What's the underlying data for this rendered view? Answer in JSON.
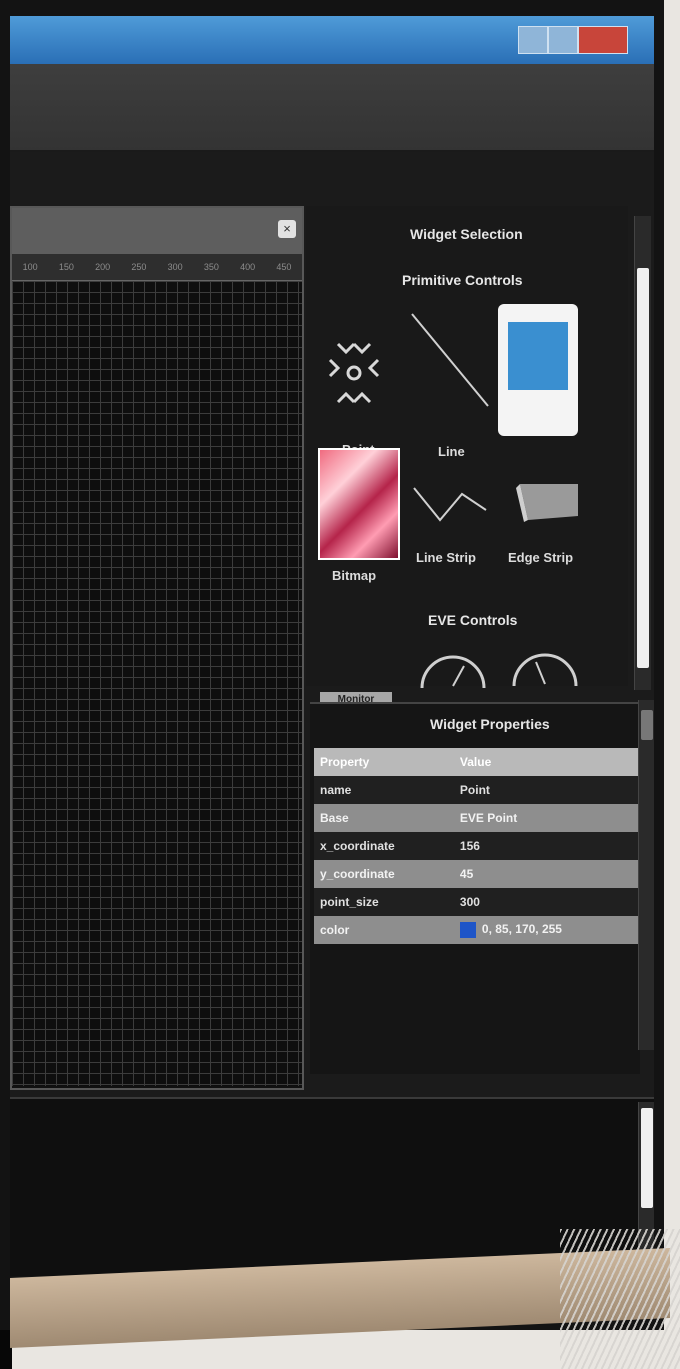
{
  "app": {
    "titlebar_color": "#2a6fb6",
    "accent": "#3a8fd0"
  },
  "canvas": {
    "ruler_ticks": [
      "100",
      "150",
      "200",
      "250",
      "300",
      "350",
      "400",
      "450"
    ]
  },
  "widget_selection": {
    "title": "Widget Selection",
    "primitive_section": "Primitive Controls",
    "special_section": "EVE Controls",
    "widgets": [
      {
        "label": "Point",
        "icon": "point-icon"
      },
      {
        "label": "Line",
        "icon": "line-icon"
      },
      {
        "label": "Bitmap",
        "icon": "bitmap-icon"
      },
      {
        "label": "Line Strip",
        "icon": "line-strip-icon"
      },
      {
        "label": "Edge Strip",
        "icon": "edge-strip-icon"
      }
    ]
  },
  "monitor_tab": "Monitor",
  "properties": {
    "title": "Widget Properties",
    "columns": [
      "Property",
      "Value"
    ],
    "rows": [
      {
        "property": "name",
        "value": "Point"
      },
      {
        "property": "Base",
        "value": "EVE Point"
      },
      {
        "property": "x_coordinate",
        "value": "156"
      },
      {
        "property": "y_coordinate",
        "value": "45"
      },
      {
        "property": "point_size",
        "value": "300"
      },
      {
        "property": "color",
        "value": "0, 85, 170, 255",
        "swatch": "#1e55c8"
      }
    ]
  }
}
